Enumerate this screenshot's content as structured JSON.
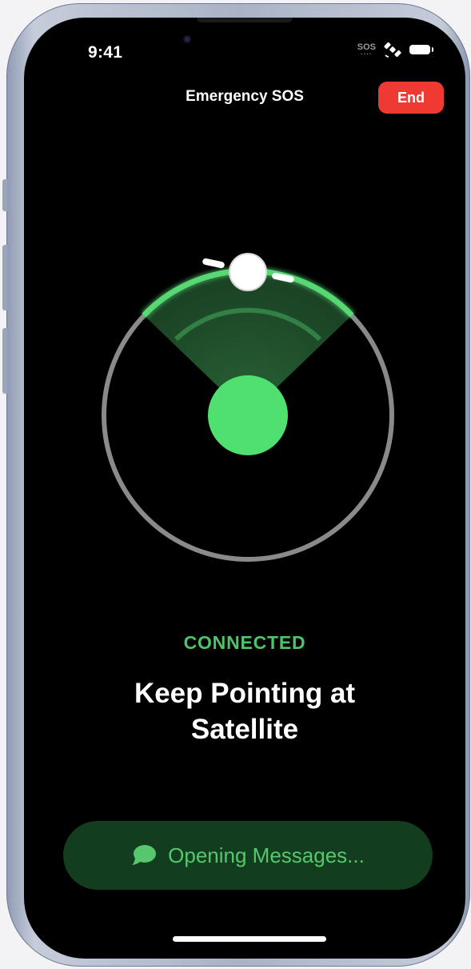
{
  "status_bar": {
    "time": "9:41",
    "sos_indicator": "SOS",
    "satellite_icon": "satellite-icon",
    "battery_icon": "battery-icon"
  },
  "header": {
    "title": "Emergency SOS",
    "end_button": "End"
  },
  "colors": {
    "accent_green": "#4ec46a",
    "end_red": "#ee3a33",
    "pill_bg": "#123d1e"
  },
  "radar": {
    "satellite_icon": "satellite-marker-icon",
    "device_icon": "device-position-icon"
  },
  "status": {
    "label": "CONNECTED",
    "headline_line1": "Keep Pointing at",
    "headline_line2": "Satellite"
  },
  "messages": {
    "icon": "message-bubble-icon",
    "label": "Opening Messages..."
  }
}
